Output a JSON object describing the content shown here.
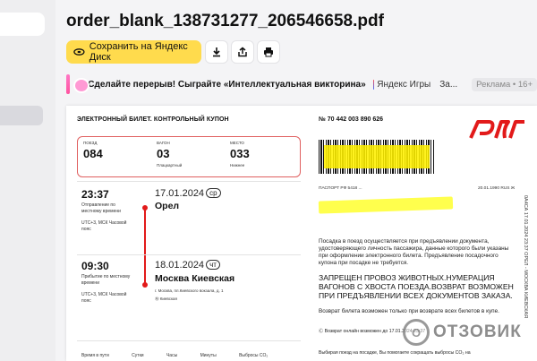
{
  "file": {
    "title": "order_blank_138731277_206546658.pdf"
  },
  "toolbar": {
    "save_label": "Сохранить на Яндекс Диск",
    "icons": [
      "download-icon",
      "share-icon",
      "print-icon"
    ],
    "accent": "#ffdb4d"
  },
  "ad": {
    "text": "Сделайте перерыв! Сыграйте «Интеллектуальная викторина»",
    "brand": "Яндекс Игры",
    "more": "За...",
    "badge": "Реклама • 16+"
  },
  "ticket": {
    "header": "ЭЛЕКТРОННЫЙ БИЛЕТ. КОНТРОЛЬНЫЙ КУПОН",
    "number": "№ 70 442 003 890 626",
    "brand_color": "#e21a1a",
    "train": {
      "label": "ПОЕЗД",
      "value": "084"
    },
    "car": {
      "label": "ВАГОН",
      "value": "03",
      "sub": "Плацкартный"
    },
    "seat": {
      "label": "МЕСТО",
      "value": "033",
      "sub": "Нижнее"
    },
    "departure": {
      "time": "23:37",
      "desc1": "Отправление по местному времени",
      "desc2": "UTC+3, МСК Часовой пояс",
      "date": "17.01.2024",
      "dow": "ср",
      "station": "Орел"
    },
    "arrival": {
      "time": "09:30",
      "desc1": "Прибытие по местному времени",
      "desc2": "UTC+3, МСК Часовой пояс",
      "date": "18.01.2024",
      "dow": "чт",
      "station": "Москва Киевская",
      "address": "г. Москва, пл.Киевского вокзала, д. 1",
      "metro": "Ⓜ Киевская"
    },
    "bottom_labels": [
      "Время в пути",
      "Сутки",
      "Часы",
      "Минуты",
      "Выбросы CO₂"
    ],
    "passport_label": "ПАСПОРТ РФ 5418 ...",
    "birth_date": "20.01.1990 RUS Ж",
    "info1": "Посадка в поезд осуществляется при предъявлении документа, удостоверяющего личность пассажира, данные которого были указаны при оформлении электронного билета. Предъявление посадочного купона при посадке не требуется.",
    "warning": "ЗАПРЕЩЕН ПРОВОЗ ЖИВОТНЫХ.НУМЕРАЦИЯ ВАГОНОВ С ХВОСТА ПОЕЗДА.ВОЗВРАТ ВОЗМОЖЕН ПРИ ПРЕДЪЯВЛЕНИИ ВСЕХ ДОКУМЕНТОВ ЗАКАЗА.",
    "info2": "Возврат билета возможен только при возврате всех билетов в купе.",
    "info3": "Ⓒ Возврат онлайн возможен до 17.01.2024 23:37",
    "info4": "Выбирая поезд на посадке, Вы помогаете сокращать выбросы CO₂ на",
    "vertical": "0А4СА 17.01.2024 23:37 ОРЕЛ - МОСКВА КИЕВСКАЯ"
  },
  "watermark": {
    "text": "ОТЗОВИК"
  }
}
